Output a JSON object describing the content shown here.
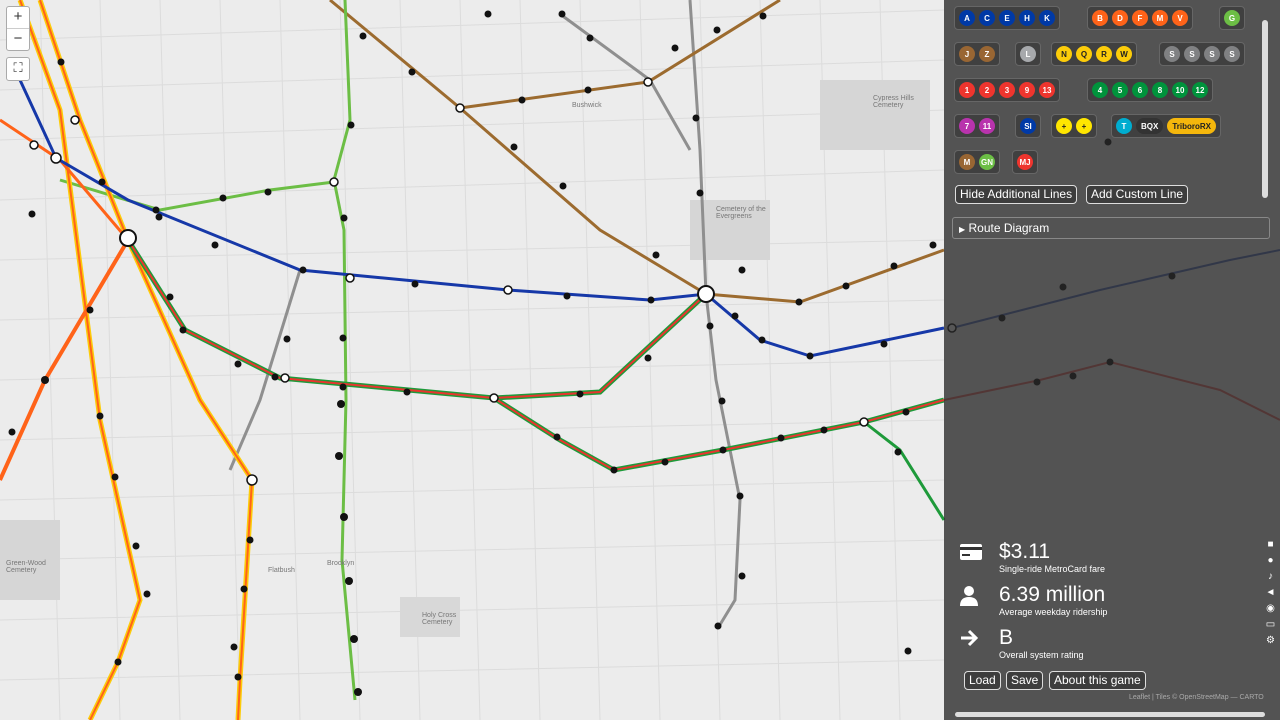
{
  "map": {
    "zoom_in": "+",
    "zoom_out": "−",
    "fullscreen": "⛶",
    "labels": [
      "Flatbush",
      "Brooklyn",
      "Cemetery of the Evergreens",
      "Bushwick",
      "Holy Cross Cemetery",
      "Green-Wood Cemetery",
      "Cypress Hills Cemetery"
    ]
  },
  "line_groups": [
    [
      {
        "l": "A",
        "c": "#0039A6"
      },
      {
        "l": "C",
        "c": "#0039A6"
      },
      {
        "l": "E",
        "c": "#0039A6"
      },
      {
        "l": "H",
        "c": "#0039A6"
      },
      {
        "l": "K",
        "c": "#0039A6"
      }
    ],
    [
      {
        "l": "B",
        "c": "#FF6319"
      },
      {
        "l": "D",
        "c": "#FF6319"
      },
      {
        "l": "F",
        "c": "#FF6319"
      },
      {
        "l": "M",
        "c": "#FF6319"
      },
      {
        "l": "V",
        "c": "#FF6319"
      }
    ],
    [
      {
        "l": "G",
        "c": "#6CBE45"
      }
    ],
    [
      {
        "l": "J",
        "c": "#996633"
      },
      {
        "l": "Z",
        "c": "#996633"
      }
    ],
    [
      {
        "l": "L",
        "c": "#A7A9AC"
      }
    ],
    [
      {
        "l": "N",
        "c": "#FCCC0A",
        "t": "#222"
      },
      {
        "l": "Q",
        "c": "#FCCC0A",
        "t": "#222"
      },
      {
        "l": "R",
        "c": "#FCCC0A",
        "t": "#222"
      },
      {
        "l": "W",
        "c": "#FCCC0A",
        "t": "#222"
      }
    ],
    [
      {
        "l": "S",
        "c": "#808183"
      },
      {
        "l": "S",
        "c": "#808183"
      },
      {
        "l": "S",
        "c": "#808183"
      },
      {
        "l": "S",
        "c": "#808183"
      }
    ],
    [
      {
        "l": "1",
        "c": "#EE352E"
      },
      {
        "l": "2",
        "c": "#EE352E"
      },
      {
        "l": "3",
        "c": "#EE352E"
      },
      {
        "l": "9",
        "c": "#EE352E"
      },
      {
        "l": "13",
        "c": "#EE352E"
      }
    ],
    [
      {
        "l": "4",
        "c": "#00933C"
      },
      {
        "l": "5",
        "c": "#00933C"
      },
      {
        "l": "6",
        "c": "#00933C"
      },
      {
        "l": "8",
        "c": "#00933C"
      },
      {
        "l": "10",
        "c": "#00933C"
      },
      {
        "l": "12",
        "c": "#00933C"
      }
    ],
    [
      {
        "l": "7",
        "c": "#B933AD"
      },
      {
        "l": "11",
        "c": "#B933AD"
      }
    ],
    [
      {
        "l": "SI",
        "c": "#0039A6"
      }
    ],
    [
      {
        "l": "+",
        "c": "#FFE600",
        "t": "#222"
      },
      {
        "l": "+",
        "c": "#FFE600",
        "t": "#222"
      }
    ],
    [
      {
        "l": "T",
        "c": "#00ADD0"
      },
      {
        "l": "BQX",
        "c": "#333333"
      },
      {
        "l": "TriboroRX",
        "c": "#F5B70C",
        "t": "#222"
      }
    ],
    [
      {
        "l": "M",
        "c": "#996633"
      },
      {
        "l": "GN",
        "c": "#6CBE45"
      }
    ],
    [
      {
        "l": "MJ",
        "c": "#EE352E"
      }
    ]
  ],
  "buttons": {
    "hide_lines": "Hide Additional Lines",
    "add_custom": "Add Custom Line",
    "load": "Load",
    "save": "Save",
    "about": "About this game"
  },
  "route_diagram": "Route Diagram",
  "stats": {
    "fare_value": "$3.11",
    "fare_label": "Single-ride MetroCard fare",
    "ridership_value": "6.39 million",
    "ridership_label": "Average weekday ridership",
    "rating_value": "B",
    "rating_label": "Overall system rating"
  },
  "attribution": "Leaflet | Tiles © OpenStreetMap — CARTO",
  "colors": {
    "blue": "#1638a8",
    "green": "#1e9a3a",
    "red": "#e8352e",
    "orange": "#ff6319",
    "yellow": "#fccc0a",
    "brown": "#9c6b2f",
    "gray": "#8f8f8f",
    "lightgreen": "#6cbe45"
  }
}
